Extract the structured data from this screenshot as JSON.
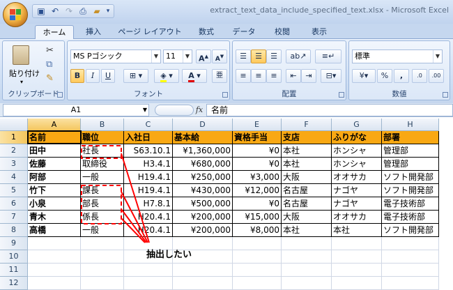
{
  "window": {
    "title": "extract_text_data_include_specified_text.xlsx - Microsoft Excel"
  },
  "ribbon_tabs": [
    "ホーム",
    "挿入",
    "ページ レイアウト",
    "数式",
    "データ",
    "校閲",
    "表示"
  ],
  "clipboard": {
    "paste_label": "貼り付け",
    "group_label": "クリップボード"
  },
  "font": {
    "name": "MS Pゴシック",
    "size": "11",
    "group_label": "フォント",
    "bold": "B",
    "italic": "I",
    "underline": "U"
  },
  "alignment": {
    "group_label": "配置"
  },
  "number": {
    "format": "標準",
    "group_label": "数値",
    "currency": "¥",
    "percent": "%",
    "comma": ","
  },
  "formula_bar": {
    "name_box": "A1",
    "fx": "fx",
    "content": "名前"
  },
  "columns": [
    "A",
    "B",
    "C",
    "D",
    "E",
    "F",
    "G",
    "H"
  ],
  "rows": [
    "1",
    "2",
    "3",
    "4",
    "5",
    "6",
    "7",
    "8",
    "9",
    "10",
    "11",
    "12"
  ],
  "table": {
    "headers": [
      "名前",
      "職位",
      "入社日",
      "基本給",
      "資格手当",
      "支店",
      "ふりがな",
      "部署"
    ],
    "rows": [
      [
        "田中",
        "社長",
        "S63.10.1",
        "¥1,360,000",
        "¥0",
        "本社",
        "ホンシャ",
        "管理部"
      ],
      [
        "佐藤",
        "取締役",
        "H3.4.1",
        "¥680,000",
        "¥0",
        "本社",
        "ホンシャ",
        "管理部"
      ],
      [
        "阿部",
        "一般",
        "H19.4.1",
        "¥250,000",
        "¥3,000",
        "大阪",
        "オオサカ",
        "ソフト開発部"
      ],
      [
        "竹下",
        "課長",
        "H19.4.1",
        "¥430,000",
        "¥12,000",
        "名古屋",
        "ナゴヤ",
        "ソフト開発部"
      ],
      [
        "小泉",
        "部長",
        "H7.8.1",
        "¥500,000",
        "¥0",
        "名古屋",
        "ナゴヤ",
        "電子技術部"
      ],
      [
        "青木",
        "係長",
        "H20.4.1",
        "¥200,000",
        "¥15,000",
        "大阪",
        "オオサカ",
        "電子技術部"
      ],
      [
        "高橋",
        "一般",
        "H20.4.1",
        "¥200,000",
        "¥8,000",
        "本社",
        "本社",
        "ソフト開発部"
      ]
    ]
  },
  "annotation": {
    "text": "抽出したい",
    "color": "#ff0000"
  },
  "colors": {
    "header_fill": "#f9a813",
    "annotation": "#ff0000"
  }
}
